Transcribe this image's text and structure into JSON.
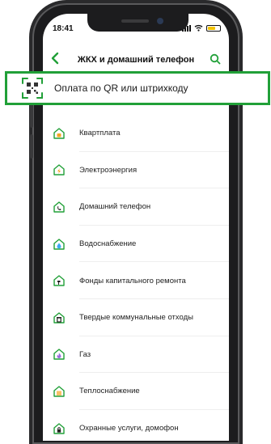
{
  "status": {
    "time": "18:41"
  },
  "header": {
    "title": "ЖКХ и домашний телефон"
  },
  "qr": {
    "label": "Оплата по QR или штрихкоду"
  },
  "items": [
    {
      "label": "Квартплата",
      "icon": "house-icon"
    },
    {
      "label": "Электроэнергия",
      "icon": "lightning-icon"
    },
    {
      "label": "Домашний телефон",
      "icon": "phone-icon"
    },
    {
      "label": "Водоснабжение",
      "icon": "water-drop-icon"
    },
    {
      "label": "Фонды капитального ремонта",
      "icon": "hammer-icon"
    },
    {
      "label": "Твердые коммунальные отходы",
      "icon": "trash-icon"
    },
    {
      "label": "Газ",
      "icon": "gas-flame-icon"
    },
    {
      "label": "Теплоснабжение",
      "icon": "heat-icon"
    },
    {
      "label": "Охранные услуги, домофон",
      "icon": "lock-icon"
    }
  ],
  "colors": {
    "accent": "#21a038",
    "icon_orange": "#f5a623",
    "icon_blue": "#3ea9f5",
    "icon_purple": "#9b6be0"
  }
}
